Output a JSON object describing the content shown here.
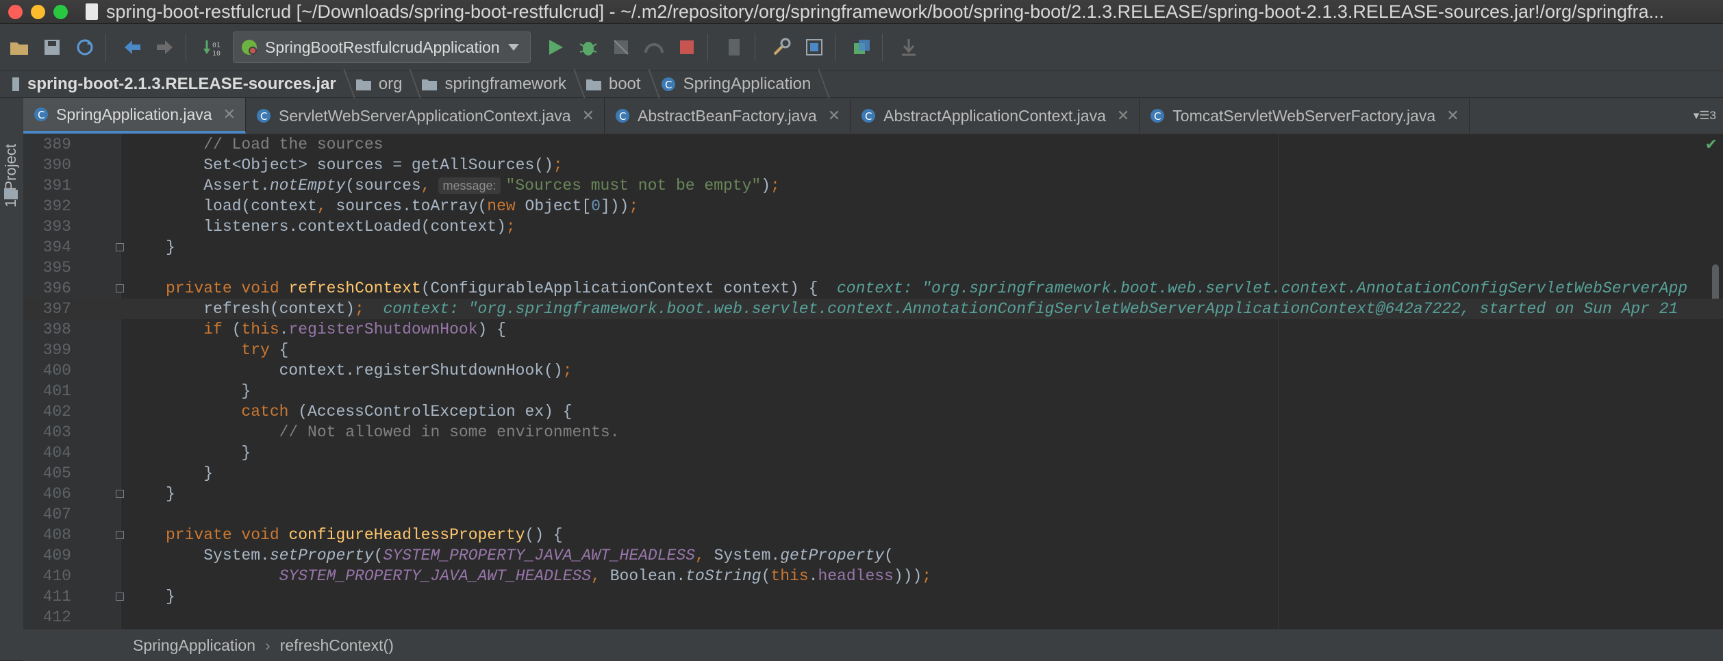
{
  "window": {
    "title": "spring-boot-restfulcrud [~/Downloads/spring-boot-restfulcrud] - ~/.m2/repository/org/springframework/boot/spring-boot/2.1.3.RELEASE/spring-boot-2.1.3.RELEASE-sources.jar!/org/springfra..."
  },
  "toolbar": {
    "run_config": "SpringBootRestfulcrudApplication"
  },
  "breadcrumbs": [
    "spring-boot-2.1.3.RELEASE-sources.jar",
    "org",
    "springframework",
    "boot",
    "SpringApplication"
  ],
  "left_panel": {
    "label": "1: Project"
  },
  "tabs": [
    {
      "label": "SpringApplication.java",
      "active": true
    },
    {
      "label": "ServletWebServerApplicationContext.java",
      "active": false
    },
    {
      "label": "AbstractBeanFactory.java",
      "active": false
    },
    {
      "label": "AbstractApplicationContext.java",
      "active": false
    },
    {
      "label": "TomcatServletWebServerFactory.java",
      "active": false
    }
  ],
  "tab_overflow_count": "3",
  "editor": {
    "lines": [
      "389",
      "390",
      "391",
      "392",
      "393",
      "394",
      "395",
      "396",
      "397",
      "398",
      "399",
      "400",
      "401",
      "402",
      "403",
      "404",
      "405",
      "406",
      "407",
      "408",
      "409",
      "410",
      "411",
      "412"
    ],
    "hint_message": "message:",
    "debug_context_396": "context: \"org.springframework.boot.web.servlet.context.AnnotationConfigServletWebServerApp",
    "debug_context_397": "context: \"org.springframework.boot.web.servlet.context.AnnotationConfigServletWebServerApplicationContext@642a7222, started on Sun Apr 21"
  },
  "status": {
    "class": "SpringApplication",
    "method": "refreshContext()"
  },
  "colors": {
    "keyword": "#cc7832",
    "method": "#ffc66d",
    "string": "#6a8759",
    "number": "#6897bb",
    "field": "#9876aa",
    "accent": "#4a88c7"
  }
}
